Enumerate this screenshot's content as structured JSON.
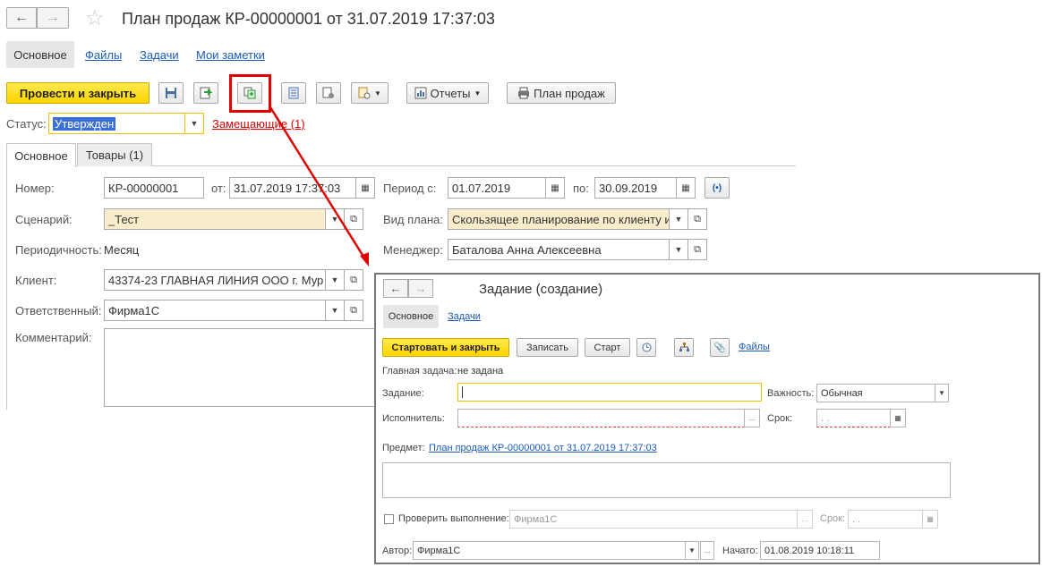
{
  "window": {
    "title": "План продаж КР-00000001 от 31.07.2019 17:37:03",
    "nav_back": "←",
    "nav_forward": "→",
    "star": "☆"
  },
  "top_tabs": [
    "Основное",
    "Файлы",
    "Задачи",
    "Мои заметки"
  ],
  "toolbar": {
    "post_close": "Провести и закрыть",
    "reports": "Отчеты",
    "sales_plan": "План продаж"
  },
  "status": {
    "label": "Статус:",
    "value": "Утвержден",
    "replacing_link": "Замещающие (1)"
  },
  "page_tabs": [
    "Основное",
    "Товары (1)"
  ],
  "form": {
    "number_label": "Номер:",
    "number_value": "КР-00000001",
    "from_label": "от:",
    "from_value": "31.07.2019 17:37:03",
    "period_label": "Период с:",
    "period_from": "01.07.2019",
    "period_to_label": "по:",
    "period_to": "30.09.2019",
    "scenario_label": "Сценарий:",
    "scenario_value": "_Тест",
    "plan_type_label": "Вид плана:",
    "plan_type_value": "Скользящее планирование по клиенту и",
    "periodicity_label": "Периодичность:",
    "periodicity_value": "Месяц",
    "manager_label": "Менеджер:",
    "manager_value": "Баталова Анна Алексеевна",
    "client_label": "Клиент:",
    "client_value": "43374-23 ГЛАВНАЯ ЛИНИЯ ООО г. Мур",
    "responsible_label": "Ответственный:",
    "responsible_value": "Фирма1С",
    "comment_label": "Комментарий:",
    "comment_value": ""
  },
  "dialog": {
    "title": "Задание (создание)",
    "tabs": [
      "Основное",
      "Задачи"
    ],
    "start_close": "Стартовать и закрыть",
    "save": "Записать",
    "start": "Старт",
    "files": "Файлы",
    "main_task_label": "Главная задача:",
    "main_task_value": "не задана",
    "task_label": "Задание:",
    "task_value": "",
    "importance_label": "Важность:",
    "importance_value": "Обычная",
    "executor_label": "Исполнитель:",
    "executor_value": "",
    "deadline_label": "Срок:",
    "deadline_value": ". .",
    "subject_label": "Предмет:",
    "subject_link": "План продаж КР-00000001 от 31.07.2019 17:37:03",
    "check_label": "Проверить выполнение:",
    "check_value": "Фирма1С",
    "check_deadline_label": "Срок:",
    "check_deadline_value": ". .",
    "author_label": "Автор:",
    "author_value": "Фирма1С",
    "start_label": "Начато:",
    "start_value": "01.08.2019 10:18:11",
    "ellipsis": "..."
  },
  "colors": {
    "accent_yellow": "#ffd500",
    "link_blue": "#1b5bb7",
    "highlight_red": "#e00000",
    "field_yellow": "#fbeccb"
  }
}
